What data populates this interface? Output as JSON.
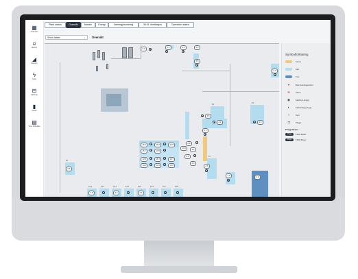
{
  "sidebar": {
    "items": [
      {
        "label": "Overview",
        "icon": "overview-icon"
      },
      {
        "label": "Alarms",
        "icon": "bell-icon"
      },
      {
        "label": "Reports",
        "icon": "chart-area-icon"
      },
      {
        "label": "Stats",
        "icon": "bolt-icon"
      },
      {
        "label": "Settings",
        "icon": "settings-icon"
      },
      {
        "label": "Graph",
        "icon": "bar-chart-icon"
      },
      {
        "label": "Time Schedule",
        "icon": "calendar-icon"
      }
    ]
  },
  "tabs": [
    {
      "label": "Plant status",
      "active": false
    },
    {
      "label": "Oversikt",
      "active": true
    },
    {
      "label": "Maskin",
      "active": false
    },
    {
      "label": "Energi",
      "active": false
    },
    {
      "label": "Varmegjenvinning",
      "active": false
    },
    {
      "label": "36.01 Ventilasjon",
      "active": false
    },
    {
      "label": "Operation status",
      "active": false
    }
  ],
  "select": {
    "value": "Show latest"
  },
  "view_title": "Oversikt",
  "map": {
    "pills": [
      "5.2",
      "6.1",
      "4.4",
      "5.3",
      "5.8",
      "2.3",
      "3.6",
      "2.2",
      "2.4",
      "2.5",
      "15.4",
      "18.2",
      "13.5",
      "15.7",
      "13.9",
      "13.5",
      "16.7",
      "10.7",
      "14.6",
      "12.6",
      "10.6",
      "13.4",
      "2.8",
      "4.2",
      "3.8",
      "2.3",
      "2.6",
      "1.9",
      "2.9",
      "2.6",
      "2.8",
      "3.2",
      "4.1"
    ],
    "labels": [
      "K1.1",
      "K1.2",
      "K1.3",
      "K1.4",
      "K1.5",
      "K1.6",
      "K1.7",
      "K1.8",
      "K2",
      "K4",
      "K6",
      "K7"
    ]
  },
  "legend": {
    "title": "Symbolforklaring",
    "items": [
      {
        "label": "Sonne",
        "kind": "swatch",
        "color": "#f0c981"
      },
      {
        "label": "Kjøl",
        "kind": "swatch",
        "color": "#b4dcef"
      },
      {
        "label": "Frys",
        "kind": "swatch",
        "color": "#5d8fc0"
      },
      {
        "label": "Brannvarslingsenhet",
        "kind": "icon",
        "icon": "fire-alarm-icon",
        "color": "#d93a3a"
      },
      {
        "label": "Alarm",
        "kind": "icon",
        "icon": "alarm-icon",
        "color": "#d93a3a"
      },
      {
        "label": "Kjøl/Frys-pluggi",
        "kind": "icon",
        "icon": "plug-sensor-icon",
        "color": "#2b3440"
      },
      {
        "label": "Kjøleanlegg pluggi",
        "kind": "icon",
        "icon": "cooling-icon",
        "color": "#2b3440"
      },
      {
        "label": "Vent",
        "kind": "icon",
        "icon": "vent-icon",
        "color": "#2b3440"
      },
      {
        "label": "Pluggi",
        "kind": "icon",
        "icon": "pluggi-icon",
        "color": "#2b3440"
      }
    ],
    "subheading": "Pluggi-Bryter",
    "tags": [
      {
        "tag": "Plugg",
        "label": "FDVA Bryter"
      },
      {
        "tag": "Plugg",
        "label": "FDVA Bryter"
      }
    ]
  }
}
